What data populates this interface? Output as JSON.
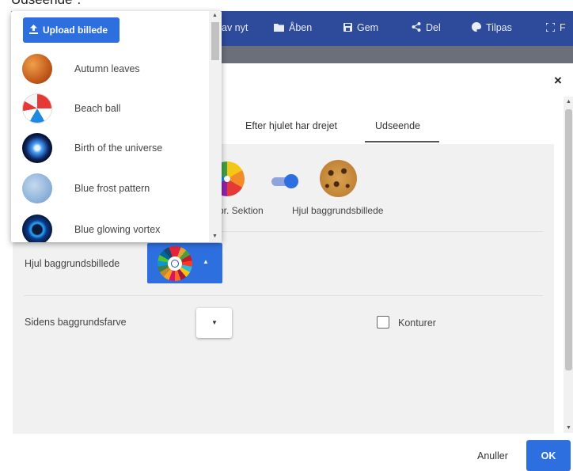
{
  "doc_caption": "Udseende\".",
  "toolbar": {
    "items": [
      {
        "label": "av nyt",
        "icon": ""
      },
      {
        "label": "Åben",
        "icon": "folder-icon"
      },
      {
        "label": "Gem",
        "icon": "save-icon"
      },
      {
        "label": "Del",
        "icon": "share-icon"
      },
      {
        "label": "Tilpas",
        "icon": "palette-icon"
      },
      {
        "label": "F",
        "icon": "fullscreen-icon"
      }
    ]
  },
  "dialog": {
    "close_symbol": "×",
    "tabs": [
      {
        "label": "Efter hjulet har drejet",
        "active": false
      },
      {
        "label": "Udseende",
        "active": true
      }
    ],
    "preview_labels": {
      "sektion": "pr. Sektion",
      "background_image": "Hjul baggrundsbillede"
    },
    "fields": {
      "wheel_bg_label": "Hjul baggrundsbillede",
      "page_bg_label": "Sidens baggrundsfarve",
      "outlines_label": "Konturer",
      "outlines_checked": false
    },
    "footer": {
      "cancel": "Anuller",
      "ok": "OK"
    }
  },
  "dropdown": {
    "upload_label": "Upload billede",
    "items": [
      {
        "label": "Autumn leaves"
      },
      {
        "label": "Beach ball"
      },
      {
        "label": "Birth of the universe"
      },
      {
        "label": "Blue frost pattern"
      },
      {
        "label": "Blue glowing vortex"
      }
    ]
  },
  "colors": {
    "toolbar_bg": "#2e4a9b",
    "accent": "#2e6fe0",
    "panel_bg": "#f1f1f1"
  }
}
